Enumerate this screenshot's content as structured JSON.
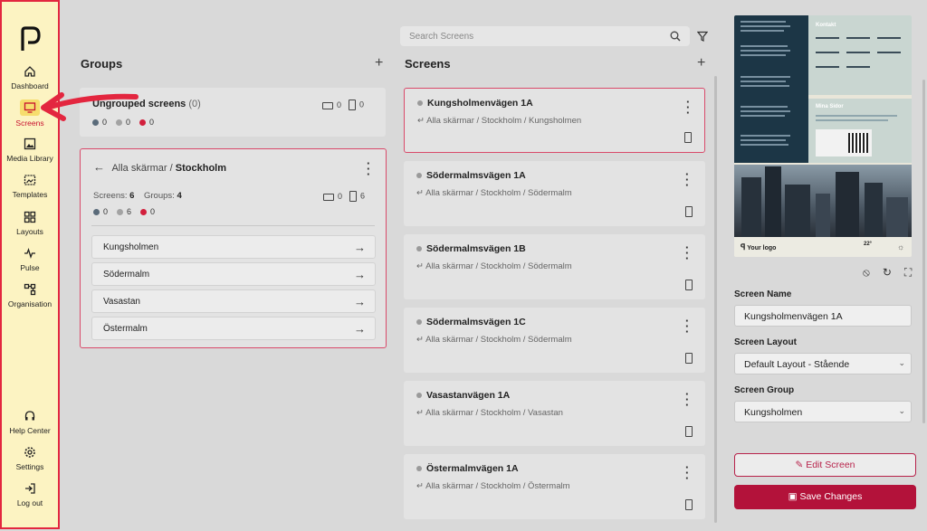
{
  "sidebar": {
    "items": [
      {
        "label": "Dashboard"
      },
      {
        "label": "Screens"
      },
      {
        "label": "Media Library"
      },
      {
        "label": "Templates"
      },
      {
        "label": "Layouts"
      },
      {
        "label": "Pulse"
      },
      {
        "label": "Organisation"
      },
      {
        "label": "Help Center"
      },
      {
        "label": "Settings"
      },
      {
        "label": "Log out"
      }
    ]
  },
  "groups": {
    "title": "Groups",
    "ungrouped": {
      "title": "Ungrouped screens",
      "count": "(0)",
      "landscape": "0",
      "portrait": "0",
      "status": [
        "0",
        "0",
        "0"
      ]
    },
    "current": {
      "parent": "Alla skärmar /",
      "name": "Stockholm",
      "screens_label": "Screens:",
      "screens_value": "6",
      "groups_label": "Groups:",
      "groups_value": "4",
      "landscape": "0",
      "portrait": "6",
      "status": [
        "0",
        "6",
        "0"
      ],
      "subgroups": [
        "Kungsholmen",
        "Södermalm",
        "Vasastan",
        "Östermalm"
      ]
    }
  },
  "search": {
    "placeholder": "Search Screens"
  },
  "screens": {
    "title": "Screens",
    "items": [
      {
        "name": "Kungsholmenvägen 1A",
        "path": "Alla skärmar / Stockholm / Kungsholmen"
      },
      {
        "name": "Södermalmsvägen 1A",
        "path": "Alla skärmar / Stockholm / Södermalm"
      },
      {
        "name": "Södermalmsvägen 1B",
        "path": "Alla skärmar / Stockholm / Södermalm"
      },
      {
        "name": "Södermalmsvägen 1C",
        "path": "Alla skärmar / Stockholm / Södermalm"
      },
      {
        "name": "Vasastanvägen 1A",
        "path": "Alla skärmar / Stockholm / Vasastan"
      },
      {
        "name": "Östermalmvägen 1A",
        "path": "Alla skärmar / Stockholm / Östermalm"
      }
    ]
  },
  "preview": {
    "kontakt": "Kontakt",
    "mina_sidor": "Mina Sidor",
    "logo_text": "Your logo",
    "temp": "22°"
  },
  "details": {
    "name_label": "Screen Name",
    "name_value": "Kungsholmenvägen 1A",
    "layout_label": "Screen Layout",
    "layout_value": "Default Layout - Stående",
    "group_label": "Screen Group",
    "group_value": "Kungsholmen",
    "edit_label": "Edit Screen",
    "save_label": "Save Changes"
  },
  "colors": {
    "accent": "#b3123a",
    "highlight": "#e3263f",
    "sidebar_bg": "#fcf3c2"
  }
}
